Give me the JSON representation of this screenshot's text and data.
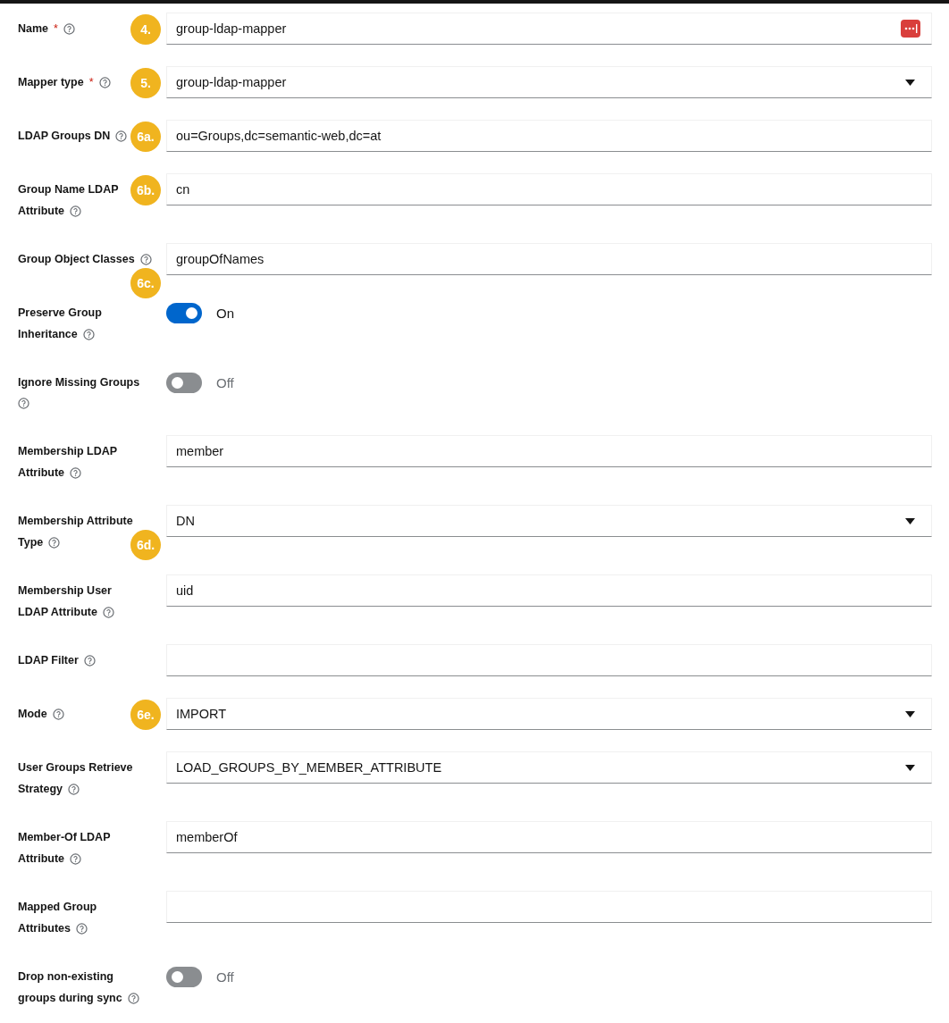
{
  "fields": [
    {
      "label": [
        "Name"
      ],
      "required_mark": "*",
      "kind": "text",
      "value": "group-ldap-mapper",
      "has_extension_icon": true,
      "badge": {
        "text": "4.",
        "kind": "aligned"
      }
    },
    {
      "label": [
        "Mapper type"
      ],
      "required_mark": "*",
      "kind": "select",
      "value": "group-ldap-mapper",
      "badge": {
        "text": "5.",
        "kind": "aligned"
      }
    },
    {
      "label": [
        "LDAP Groups DN"
      ],
      "kind": "text",
      "value": "ou=Groups,dc=semantic-web,dc=at",
      "badge": {
        "text": "6a.",
        "kind": "aligned"
      }
    },
    {
      "label": [
        "Group Name LDAP",
        "Attribute"
      ],
      "kind": "text",
      "value": "cn",
      "badge": {
        "text": "6b.",
        "kind": "aligned"
      }
    },
    {
      "label": [
        "Group Object Classes"
      ],
      "kind": "text",
      "value": "groupOfNames",
      "badge": {
        "text": "6c.",
        "kind": "lower"
      }
    },
    {
      "label": [
        "Preserve Group",
        "Inheritance"
      ],
      "kind": "toggle",
      "on": true,
      "state_label": "On"
    },
    {
      "label": [
        "Ignore Missing Groups"
      ],
      "kind": "toggle",
      "on": false,
      "state_label": "Off"
    },
    {
      "label": [
        "Membership LDAP",
        "Attribute"
      ],
      "kind": "text",
      "value": "member"
    },
    {
      "label": [
        "Membership Attribute",
        "Type"
      ],
      "kind": "select",
      "value": "DN",
      "badge": {
        "text": "6d.",
        "kind": "lower"
      }
    },
    {
      "label": [
        "Membership User",
        "LDAP Attribute"
      ],
      "kind": "text",
      "value": "uid"
    },
    {
      "label": [
        "LDAP Filter"
      ],
      "kind": "text"
    },
    {
      "label": [
        "Mode"
      ],
      "kind": "select",
      "value": "IMPORT",
      "badge": {
        "text": "6e.",
        "kind": "aligned"
      }
    },
    {
      "label": [
        "User Groups Retrieve",
        "Strategy"
      ],
      "kind": "select",
      "value": "LOAD_GROUPS_BY_MEMBER_ATTRIBUTE"
    },
    {
      "label": [
        "Member-Of LDAP",
        "Attribute"
      ],
      "kind": "text",
      "value": "memberOf"
    },
    {
      "label": [
        "Mapped Group",
        "Attributes"
      ],
      "kind": "text"
    },
    {
      "label": [
        "Drop non-existing",
        "groups during sync"
      ],
      "kind": "toggle",
      "on": false,
      "state_label": "Off"
    }
  ]
}
